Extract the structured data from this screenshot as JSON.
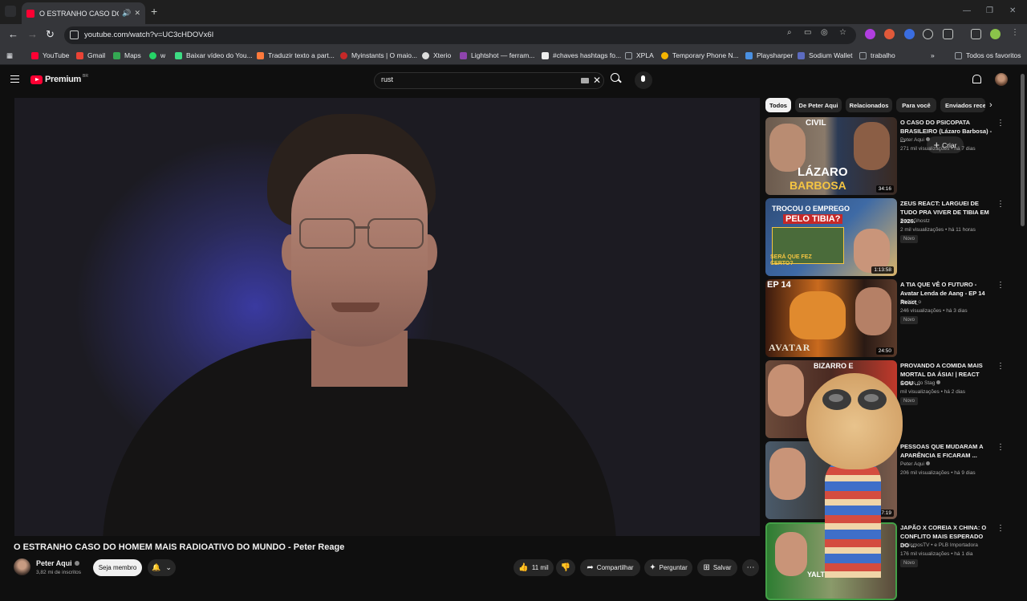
{
  "browser": {
    "tab_title": "O ESTRANHO CASO DO H",
    "url": "youtube.com/watch?v=UC3cHDOVx6I",
    "bookmarks": [
      {
        "label": "YouTube",
        "color": "#ff0033"
      },
      {
        "label": "Gmail",
        "color": "#ea4335"
      },
      {
        "label": "Maps",
        "color": "#34a853"
      },
      {
        "label": "w",
        "color": "#25d366"
      },
      {
        "label": "Baixar vídeo do You...",
        "color": "#3ddc84"
      },
      {
        "label": "Traduzir texto a part...",
        "color": "#ff7a3c"
      },
      {
        "label": "Myinstants | O maio...",
        "color": "#c62828"
      },
      {
        "label": "Xterio",
        "color": "#dddddd"
      },
      {
        "label": "Lightshot — ferram...",
        "color": "#8e44ad"
      },
      {
        "label": "#chaves hashtags fo...",
        "color": "#eeeeee"
      },
      {
        "label": "XPLA",
        "color": "#9aa0a6"
      },
      {
        "label": "Temporary Phone N...",
        "color": "#f4b400"
      },
      {
        "label": "Playsharper",
        "color": "#4a90e2"
      },
      {
        "label": "Sodium Wallet",
        "color": "#5c6bc0"
      },
      {
        "label": "trabalho",
        "color": "#9aa0a6"
      }
    ],
    "all_bookmarks": "Todos os favoritos"
  },
  "youtube": {
    "logo": "Premium",
    "logo_region": "BR",
    "search_value": "rust",
    "create_label": "Criar"
  },
  "video": {
    "title": "O ESTRANHO CASO DO HOMEM MAIS RADIOATIVO DO MUNDO - Peter Reage",
    "channel": "Peter Aqui",
    "subscribers": "3,82 mi de inscritos",
    "join_label": "Seja membro",
    "likes": "11 mil",
    "share_label": "Compartilhar",
    "ask_label": "Perguntar",
    "save_label": "Salvar"
  },
  "chips": [
    "Todos",
    "De Peter Aqui",
    "Relacionados",
    "Para você",
    "Enviados recentemente"
  ],
  "recommendations": [
    {
      "title": "O CASO DO PSICOPATA BRASILEIRO (Lázaro Barbosa) - ...",
      "channel": "Peter Aqui",
      "verified": true,
      "stats": "271 mil visualizações • há 7 dias",
      "duration": "34:16",
      "badge": ""
    },
    {
      "title": "ZEUS REACT: LARGUEI DE TUDO PRA VIVER DE TIBIA EM 2026.",
      "channel": "Zeus Ghostz",
      "verified": false,
      "stats": "2 mil visualizações • há 11 horas",
      "duration": "1:13:58",
      "badge": "Novo"
    },
    {
      "title": "A TIA QUE VÊ O FUTURO - Avatar Lenda de Aang - EP 14 React",
      "channel": "Endrio_o",
      "verified": false,
      "stats": "246 visualizações • há 3 dias",
      "duration": "24:50",
      "badge": "Novo"
    },
    {
      "title": "PROVANDO A COMIDA MAIS MORTAL DA ÁSIA! | REACT SOU ...",
      "channel": "Cortes do Stag",
      "verified": true,
      "stats": "mil visualizações • há 2 dias",
      "duration": "",
      "badge": "Novo"
    },
    {
      "title": "PESSOAS QUE MUDARAM A APARÊNCIA E FICARAM ...",
      "channel": "Peter Aqui",
      "verified": true,
      "stats": "206 mil visualizações • há 9 dias",
      "duration": "37:19",
      "badge": ""
    },
    {
      "title": "JAPÃO X COREIA X CHINA: O CONFLITO MAIS ESPERADO DO ...",
      "channel": "AchismosTV • e PLB Importadora",
      "verified": true,
      "stats": "176 mil visualizações • há 1 dia",
      "duration": "",
      "badge": "Novo"
    }
  ],
  "thumb_texts": {
    "t1_top": "CIVIL",
    "t1_a": "LÁZARO",
    "t1_b": "BARBOSA",
    "t2_a": "TROCOU O EMPREGO",
    "t2_b": "PELO TIBIA?",
    "t2_c": "SERÁ QUE FEZ CERTO?",
    "t3_ep": "EP 14",
    "t3_logo": "AVATAR",
    "t4": "BIZARRO E",
    "t6": "YALT"
  }
}
